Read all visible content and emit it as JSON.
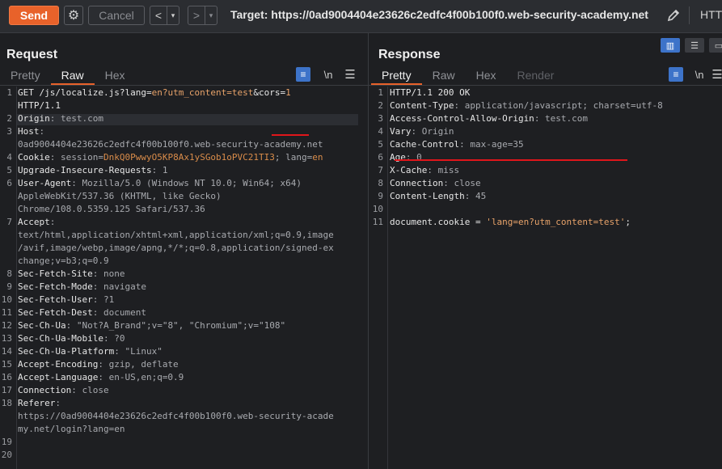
{
  "toolbar": {
    "send_label": "Send",
    "cancel_label": "Cancel",
    "back_label": "<",
    "forward_label": ">",
    "dropdown_label": "▾",
    "target_label": "Target: https://0ad9004404e23626c2edfc4f00b100f0.web-security-academy.net",
    "http_label": "HTTP"
  },
  "request": {
    "title": "Request",
    "tabs": [
      "Pretty",
      "Raw",
      "Hex"
    ],
    "active_tab": "Raw",
    "newline_label": "\\n",
    "line_numbers": [
      "1",
      "",
      "2",
      "3",
      "",
      "4",
      "5",
      "6",
      "",
      "",
      "7",
      "",
      "",
      "",
      "8",
      "9",
      "10",
      "11",
      "12",
      "13",
      "14",
      "15",
      "16",
      "17",
      "18",
      "",
      "",
      "19",
      "20"
    ],
    "lines": [
      {
        "segs": [
          {
            "t": "GET /js/localize.js?lang=",
            "c": "k"
          },
          {
            "t": "en?utm_content=test",
            "c": "s"
          },
          {
            "t": "&cors=",
            "c": "k"
          },
          {
            "t": "1",
            "c": "s"
          }
        ]
      },
      {
        "segs": [
          {
            "t": "HTTP/1.1",
            "c": "k"
          }
        ]
      },
      {
        "segs": [
          {
            "t": "Origin",
            "c": "k"
          },
          {
            "t": ": test.com",
            "c": "v"
          }
        ]
      },
      {
        "segs": [
          {
            "t": "Host",
            "c": "k"
          },
          {
            "t": ":",
            "c": "v"
          }
        ]
      },
      {
        "segs": [
          {
            "t": "0ad9004404e23626c2edfc4f00b100f0.web-security-academy.net",
            "c": "v"
          }
        ]
      },
      {
        "segs": [
          {
            "t": "Cookie",
            "c": "k"
          },
          {
            "t": ": session=",
            "c": "v"
          },
          {
            "t": "DnkQ0PwwyO5KP8Ax1ySGob1oPVC21TI3",
            "c": "sess"
          },
          {
            "t": "; lang=",
            "c": "v"
          },
          {
            "t": "en",
            "c": "sess"
          }
        ]
      },
      {
        "segs": [
          {
            "t": "Upgrade-Insecure-Requests",
            "c": "k"
          },
          {
            "t": ": 1",
            "c": "v"
          }
        ]
      },
      {
        "segs": [
          {
            "t": "User-Agent",
            "c": "k"
          },
          {
            "t": ": Mozilla/5.0 (Windows NT 10.0; Win64; x64)",
            "c": "v"
          }
        ]
      },
      {
        "segs": [
          {
            "t": "AppleWebKit/537.36 (KHTML, like Gecko)",
            "c": "v"
          }
        ]
      },
      {
        "segs": [
          {
            "t": "Chrome/108.0.5359.125 Safari/537.36",
            "c": "v"
          }
        ]
      },
      {
        "segs": [
          {
            "t": "Accept",
            "c": "k"
          },
          {
            "t": ":",
            "c": "v"
          }
        ]
      },
      {
        "segs": [
          {
            "t": "text/html,application/xhtml+xml,application/xml;q=0.9,image",
            "c": "v"
          }
        ]
      },
      {
        "segs": [
          {
            "t": "/avif,image/webp,image/apng,*/*;q=0.8,application/signed-ex",
            "c": "v"
          }
        ]
      },
      {
        "segs": [
          {
            "t": "change;v=b3;q=0.9",
            "c": "v"
          }
        ]
      },
      {
        "segs": [
          {
            "t": "Sec-Fetch-Site",
            "c": "k"
          },
          {
            "t": ": none",
            "c": "v"
          }
        ]
      },
      {
        "segs": [
          {
            "t": "Sec-Fetch-Mode",
            "c": "k"
          },
          {
            "t": ": navigate",
            "c": "v"
          }
        ]
      },
      {
        "segs": [
          {
            "t": "Sec-Fetch-User",
            "c": "k"
          },
          {
            "t": ": ?1",
            "c": "v"
          }
        ]
      },
      {
        "segs": [
          {
            "t": "Sec-Fetch-Dest",
            "c": "k"
          },
          {
            "t": ": document",
            "c": "v"
          }
        ]
      },
      {
        "segs": [
          {
            "t": "Sec-Ch-Ua",
            "c": "k"
          },
          {
            "t": ": \"Not?A_Brand\";v=\"8\", \"Chromium\";v=\"108\"",
            "c": "v"
          }
        ]
      },
      {
        "segs": [
          {
            "t": "Sec-Ch-Ua-Mobile",
            "c": "k"
          },
          {
            "t": ": ?0",
            "c": "v"
          }
        ]
      },
      {
        "segs": [
          {
            "t": "Sec-Ch-Ua-Platform",
            "c": "k"
          },
          {
            "t": ": \"Linux\"",
            "c": "v"
          }
        ]
      },
      {
        "segs": [
          {
            "t": "Accept-Encoding",
            "c": "k"
          },
          {
            "t": ": gzip, deflate",
            "c": "v"
          }
        ]
      },
      {
        "segs": [
          {
            "t": "Accept-Language",
            "c": "k"
          },
          {
            "t": ": en-US,en;q=0.9",
            "c": "v"
          }
        ]
      },
      {
        "segs": [
          {
            "t": "Connection",
            "c": "k"
          },
          {
            "t": ": close",
            "c": "v"
          }
        ]
      },
      {
        "segs": [
          {
            "t": "Referer",
            "c": "k"
          },
          {
            "t": ":",
            "c": "v"
          }
        ]
      },
      {
        "segs": [
          {
            "t": "https://0ad9004404e23626c2edfc4f00b100f0.web-security-acade",
            "c": "v"
          }
        ]
      },
      {
        "segs": [
          {
            "t": "my.net/login?lang=en",
            "c": "v"
          }
        ]
      },
      {
        "segs": []
      },
      {
        "segs": []
      }
    ]
  },
  "response": {
    "title": "Response",
    "tabs": [
      "Pretty",
      "Raw",
      "Hex",
      "Render"
    ],
    "active_tab": "Pretty",
    "newline_label": "\\n",
    "line_numbers": [
      "1",
      "2",
      "3",
      "4",
      "5",
      "6",
      "7",
      "8",
      "9",
      "10",
      "11"
    ],
    "lines": [
      {
        "segs": [
          {
            "t": "HTTP/1.1 200 OK",
            "c": "k"
          }
        ]
      },
      {
        "segs": [
          {
            "t": "Content-Type",
            "c": "k"
          },
          {
            "t": ": application/javascript; charset=utf-8",
            "c": "v"
          }
        ]
      },
      {
        "segs": [
          {
            "t": "Access-Control-Allow-Origin",
            "c": "k"
          },
          {
            "t": ": test.com",
            "c": "v"
          }
        ]
      },
      {
        "segs": [
          {
            "t": "Vary",
            "c": "k"
          },
          {
            "t": ": Origin",
            "c": "v"
          }
        ]
      },
      {
        "segs": [
          {
            "t": "Cache-Control",
            "c": "k"
          },
          {
            "t": ": max-age=35",
            "c": "v"
          }
        ]
      },
      {
        "segs": [
          {
            "t": "Age",
            "c": "k"
          },
          {
            "t": ": 0",
            "c": "v"
          }
        ]
      },
      {
        "segs": [
          {
            "t": "X-Cache",
            "c": "k"
          },
          {
            "t": ": miss",
            "c": "v"
          }
        ]
      },
      {
        "segs": [
          {
            "t": "Connection",
            "c": "k"
          },
          {
            "t": ": close",
            "c": "v"
          }
        ]
      },
      {
        "segs": [
          {
            "t": "Content-Length",
            "c": "k"
          },
          {
            "t": ": 45",
            "c": "v"
          }
        ]
      },
      {
        "segs": []
      },
      {
        "segs": [
          {
            "t": "document.cookie = ",
            "c": "k"
          },
          {
            "t": "'lang=en?utm_content=test'",
            "c": "s"
          },
          {
            "t": ";",
            "c": "k"
          }
        ]
      }
    ]
  },
  "colors": {
    "accent": "#e8622a",
    "active_blue": "#3d73c9",
    "annotation_red": "#e0161b"
  },
  "icons": [
    "gear-icon",
    "pencil-icon",
    "word-wrap-icon",
    "newline-icon",
    "menu-icon",
    "split-view-icon",
    "stacked-view-icon"
  ]
}
